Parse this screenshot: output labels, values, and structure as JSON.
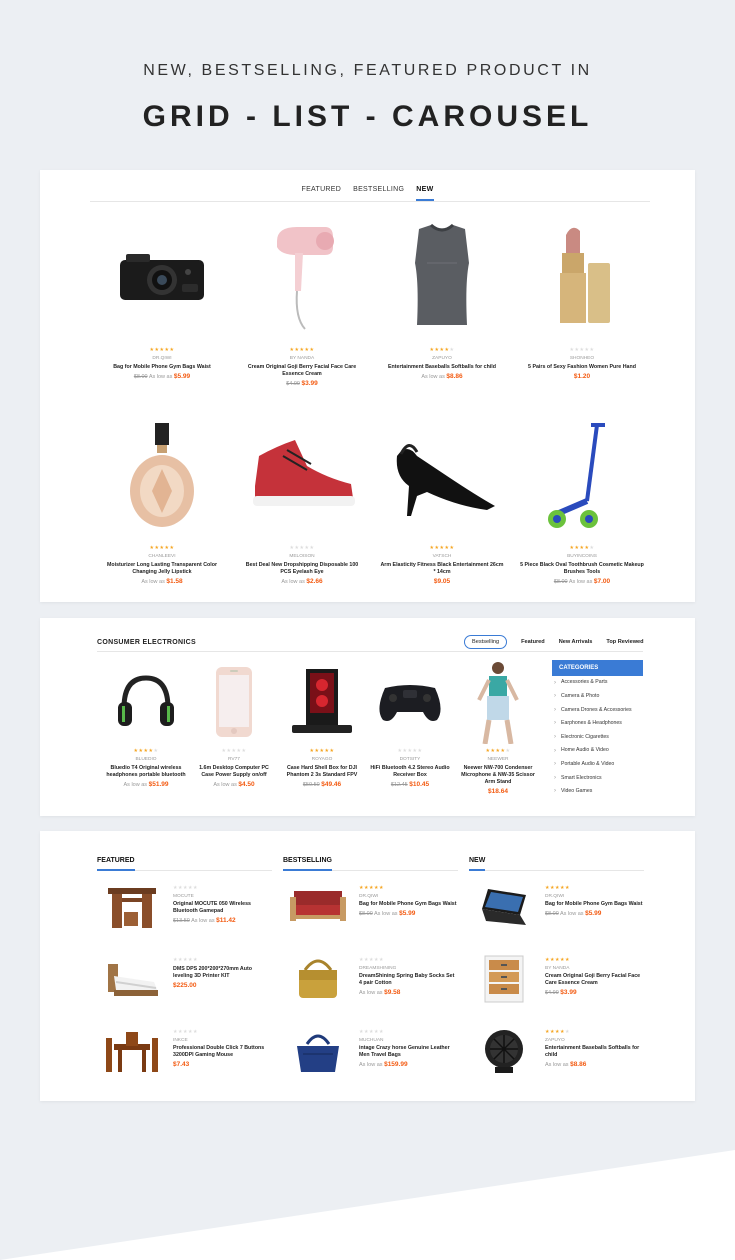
{
  "hero": {
    "subtitle": "NEW, BESTSELLING, FEATURED PRODUCT IN",
    "title": "GRID - LIST - CAROUSEL"
  },
  "grid_panel": {
    "tabs": [
      {
        "label": "FEATURED",
        "active": false
      },
      {
        "label": "BESTSELLING",
        "active": false
      },
      {
        "label": "NEW",
        "active": true
      }
    ],
    "products": [
      {
        "icon": "dashcam-icon",
        "rating": 5,
        "brand": "DR.QIWI",
        "name": "Bag for Mobile Phone Gym Bags Waist",
        "old_price": "$8.00",
        "as_low_as": "As low as",
        "price": "$5.99"
      },
      {
        "icon": "hair-dryer-icon",
        "rating": 5,
        "brand": "BY NANDA",
        "name": "Cream Original Goji Berry Facial Face Care Essence Cream",
        "old_price": "$4.99",
        "as_low_as": "",
        "price": "$3.99"
      },
      {
        "icon": "compression-shirt-icon",
        "rating": 4,
        "brand": "ZAPUYO",
        "name": "Entertainment Baseballs Softballs for child",
        "old_price": "",
        "as_low_as": "As low as",
        "price": "$8.86"
      },
      {
        "icon": "lipstick-icon",
        "rating": 0,
        "brand": "SHONHEO",
        "name": "5 Pairs of Sexy Fashion Women Pure Hand",
        "old_price": "",
        "as_low_as": "",
        "price": "$1.20"
      },
      {
        "icon": "perfume-icon",
        "rating": 5,
        "brand": "CHANLEEVI",
        "name": "Moisturizer Long Lasting Transparent Color Changing Jelly Lipstick",
        "old_price": "",
        "as_low_as": "As low as",
        "price": "$1.58"
      },
      {
        "icon": "sneaker-icon",
        "rating": 0,
        "brand": "MELOISON",
        "name": "Best Deal New Dropshipping Disposable 100 PCS Eyelash Eye",
        "old_price": "",
        "as_low_as": "As low as",
        "price": "$2.66"
      },
      {
        "icon": "high-heel-icon",
        "rating": 5,
        "brand": "VATSCH",
        "name": "Arm Elasticity Fitness Black Entertainment 26cm * 14cm",
        "old_price": "",
        "as_low_as": "",
        "price": "$9.05"
      },
      {
        "icon": "scooter-icon",
        "rating": 4,
        "brand": "BUYINCOINS",
        "name": "5 Piece Black Oval Toothbrush Cosmetic Makeup Brushes Tools",
        "old_price": "$8.00",
        "as_low_as": "As low as",
        "price": "$7.00"
      }
    ]
  },
  "carousel_panel": {
    "title": "CONSUMER ELECTRONICS",
    "tabs": [
      {
        "label": "Bestselling",
        "active": true
      },
      {
        "label": "Featured",
        "active": false
      },
      {
        "label": "New Arrivals",
        "active": false
      },
      {
        "label": "Top Reviewed",
        "active": false
      }
    ],
    "products": [
      {
        "icon": "headphones-icon",
        "rating": 4,
        "brand": "BLUEDIO",
        "name": "Bluedio T4 Original wireless headphones portable bluetooth",
        "old_price": "",
        "as_low_as": "As low as",
        "price": "$51.99"
      },
      {
        "icon": "smartphone-icon",
        "rating": 0,
        "brand": "RV77",
        "name": "1.6m Desktop Computer PC Case Power Supply on/off",
        "old_price": "",
        "as_low_as": "As low as",
        "price": "$4.50"
      },
      {
        "icon": "gaming-pc-icon",
        "rating": 5,
        "brand": "ROYAGO",
        "name": "Case Hard Shell Box for DJI Phantom 2 3s Standard FPV",
        "old_price": "$50.50",
        "as_low_as": "",
        "price": "$49.46"
      },
      {
        "icon": "gamepad-icon",
        "rating": 0,
        "brand": "DOTSITY",
        "name": "HiFi Bluetooth 4.2 Stereo Audio Receiver Box",
        "old_price": "$12.45",
        "as_low_as": "",
        "price": "$10.45"
      },
      {
        "icon": "sportswear-model-icon",
        "rating": 4,
        "brand": "NEEWER",
        "name": "Neewer NW-700 Condenser Microphone & NW-35 Scissor Arm Stand",
        "old_price": "",
        "as_low_as": "",
        "price": "$18.64"
      }
    ],
    "categories_title": "CATEGORIES",
    "categories": [
      "Accessories & Parts",
      "Camera & Photo",
      "Camera Drones & Accessories",
      "Earphones & Headphones",
      "Electronic Cigarettes",
      "Home Audio & Video",
      "Portable Audio & Video",
      "Smart Electronics",
      "Video Games"
    ]
  },
  "list_panel": {
    "columns": [
      {
        "title": "FEATURED",
        "items": [
          {
            "icon": "desk-icon",
            "rating": 0,
            "brand": "MOCUTE",
            "name": "Original MOCUTE 050 Wireless Bluetooth Gamepad",
            "old_price": "$13.50",
            "as_low_as": "As low as",
            "price": "$11.42"
          },
          {
            "icon": "bed-icon",
            "rating": 0,
            "brand": "",
            "name": "DMS DPS 200*200*270mm Auto leveling 3D Printer KIT",
            "old_price": "",
            "as_low_as": "",
            "price": "$225.00"
          },
          {
            "icon": "dining-set-icon",
            "rating": 0,
            "brand": "INKCE",
            "name": "Professional Double Click 7 Buttons 3200DPI Gaming Mouse",
            "old_price": "",
            "as_low_as": "",
            "price": "$7.43"
          }
        ]
      },
      {
        "title": "BESTSELLING",
        "items": [
          {
            "icon": "sofa-bed-icon",
            "rating": 5,
            "brand": "DR.QIWI",
            "name": "Bag for Mobile Phone Gym Bags Waist",
            "old_price": "$8.00",
            "as_low_as": "As low as",
            "price": "$5.99"
          },
          {
            "icon": "shoulder-bag-icon",
            "rating": 0,
            "brand": "DREAMSHINING",
            "name": "DreamShining Spring Baby Socks Set 4 pair Cotton",
            "old_price": "",
            "as_low_as": "As low as",
            "price": "$9.58"
          },
          {
            "icon": "handbag-icon",
            "rating": 0,
            "brand": "MUCHUAN",
            "name": "intage Crazy horse Genuine Leather Men Travel Bags",
            "old_price": "",
            "as_low_as": "As low as",
            "price": "$159.99"
          }
        ]
      },
      {
        "title": "NEW",
        "items": [
          {
            "icon": "laptop-icon",
            "rating": 5,
            "brand": "DR.QIWI",
            "name": "Bag for Mobile Phone Gym Bags Waist",
            "old_price": "$8.00",
            "as_low_as": "As low as",
            "price": "$5.99"
          },
          {
            "icon": "drawer-cabinet-icon",
            "rating": 5,
            "brand": "BY NANDA",
            "name": "Cream Original Goji Berry Facial Face Care Essence Cream",
            "old_price": "$4.99",
            "as_low_as": "",
            "price": "$3.99"
          },
          {
            "icon": "desk-fan-icon",
            "rating": 4,
            "brand": "ZAPUYO",
            "name": "Entertainment Baseballs Softballs for child",
            "old_price": "",
            "as_low_as": "As low as",
            "price": "$8.86"
          }
        ]
      }
    ]
  },
  "colors": {
    "accent": "#3a7bd5",
    "price": "#f35b12",
    "star": "#f5a623",
    "background": "#eceff3"
  }
}
